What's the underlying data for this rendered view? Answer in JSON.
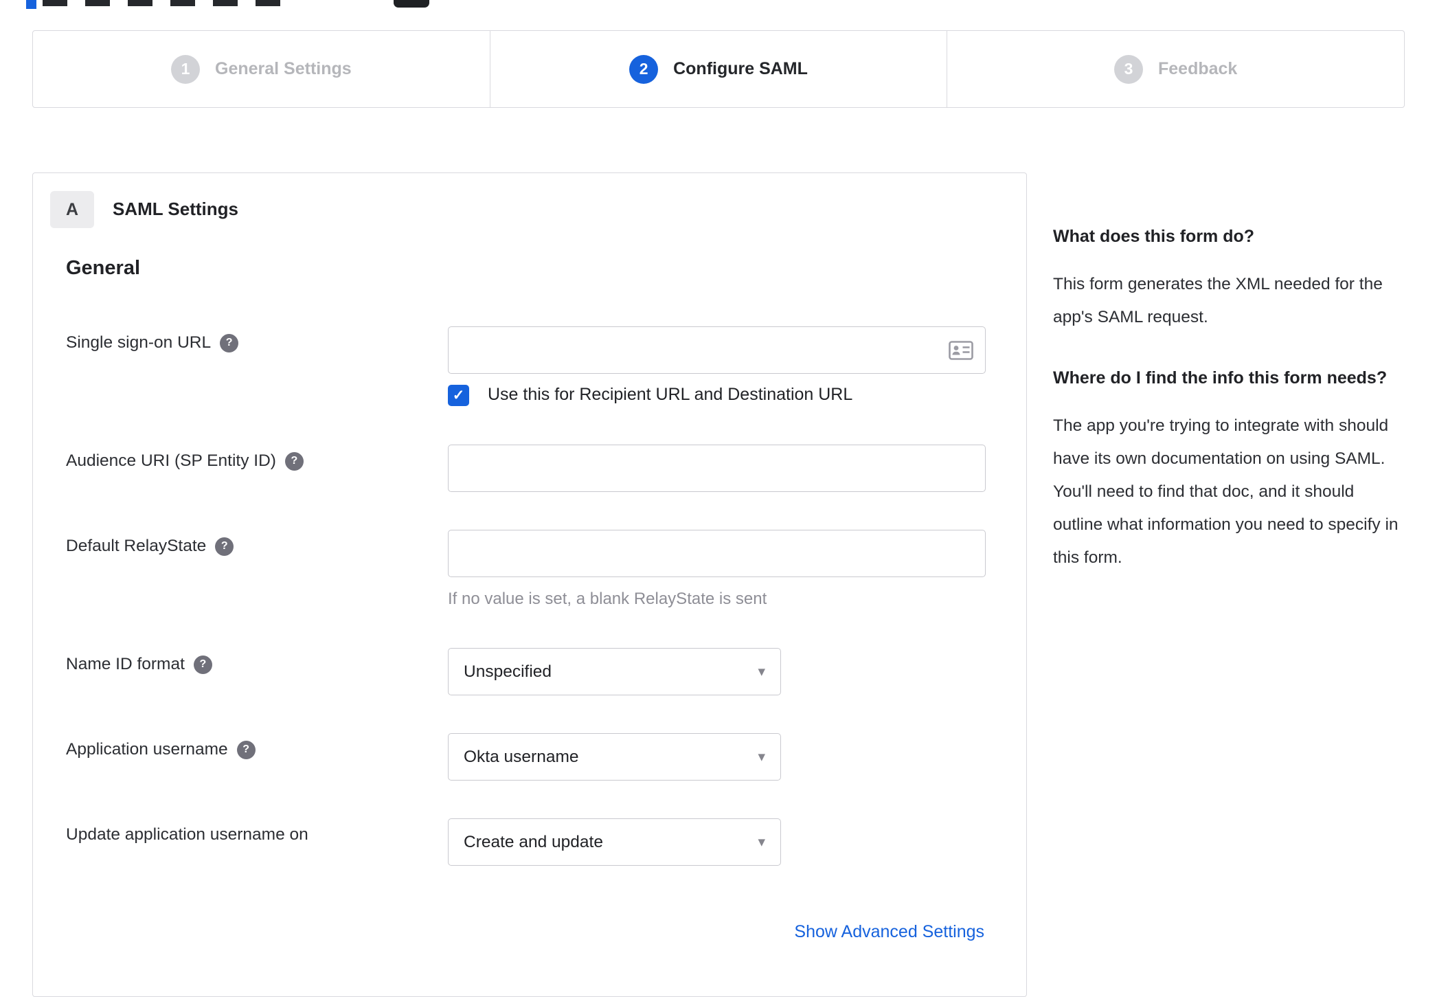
{
  "accent_color": "#1662dd",
  "icons": {
    "help": "?",
    "caret": "▾",
    "check": "✓"
  },
  "stepper": {
    "steps": [
      {
        "number": "1",
        "label": "General Settings",
        "state": "inactive"
      },
      {
        "number": "2",
        "label": "Configure SAML",
        "state": "active"
      },
      {
        "number": "3",
        "label": "Feedback",
        "state": "inactive"
      }
    ]
  },
  "panel": {
    "section_badge": "A",
    "section_title": "SAML Settings",
    "group_title": "General",
    "fields": {
      "sso": {
        "label": "Single sign-on URL",
        "value": "",
        "checkbox_label": "Use this for Recipient URL and Destination URL",
        "checkbox_checked": true
      },
      "audience": {
        "label": "Audience URI (SP Entity ID)",
        "value": ""
      },
      "relay": {
        "label": "Default RelayState",
        "value": "",
        "helper": "If no value is set, a blank RelayState is sent"
      },
      "nameid": {
        "label": "Name ID format",
        "value": "Unspecified"
      },
      "appuser": {
        "label": "Application username",
        "value": "Okta username"
      },
      "update": {
        "label": "Update application username on",
        "value": "Create and update"
      }
    },
    "advanced_link": "Show Advanced Settings"
  },
  "sidebar": {
    "q1": "What does this form do?",
    "a1": "This form generates the XML needed for the app's SAML request.",
    "q2": "Where do I find the info this form needs?",
    "a2": "The app you're trying to integrate with should have its own documentation on using SAML. You'll need to find that doc, and it should outline what information you need to specify in this form."
  }
}
